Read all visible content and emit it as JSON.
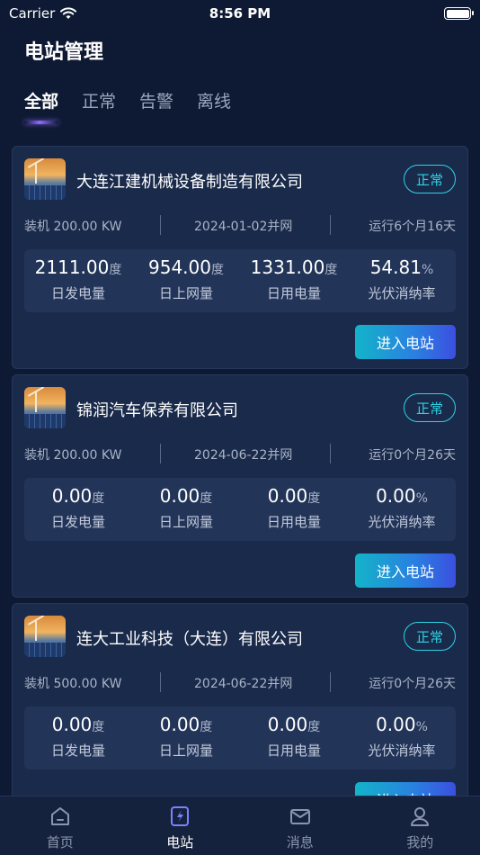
{
  "status_bar": {
    "carrier": "Carrier",
    "time": "8:56 PM",
    "battery_level": 1.0
  },
  "header": {
    "title": "电站管理"
  },
  "tabs": [
    {
      "label": "全部",
      "active": true
    },
    {
      "label": "正常",
      "active": false
    },
    {
      "label": "告警",
      "active": false
    },
    {
      "label": "离线",
      "active": false
    }
  ],
  "stations": [
    {
      "name": "大连江建机械设备制造有限公司",
      "status": "正常",
      "capacity": "装机 200.00 KW",
      "grid_date": "2024-01-02并网",
      "runtime": "运行6个月16天",
      "metrics": [
        {
          "value": "2111.00",
          "unit": "度",
          "label": "日发电量"
        },
        {
          "value": "954.00",
          "unit": "度",
          "label": "日上网量"
        },
        {
          "value": "1331.00",
          "unit": "度",
          "label": "日用电量"
        },
        {
          "value": "54.81",
          "unit": "%",
          "label": "光伏消纳率"
        }
      ],
      "button": "进入电站"
    },
    {
      "name": "锦润汽车保养有限公司",
      "status": "正常",
      "capacity": "装机 200.00 KW",
      "grid_date": "2024-06-22并网",
      "runtime": "运行0个月26天",
      "metrics": [
        {
          "value": "0.00",
          "unit": "度",
          "label": "日发电量"
        },
        {
          "value": "0.00",
          "unit": "度",
          "label": "日上网量"
        },
        {
          "value": "0.00",
          "unit": "度",
          "label": "日用电量"
        },
        {
          "value": "0.00",
          "unit": "%",
          "label": "光伏消纳率"
        }
      ],
      "button": "进入电站"
    },
    {
      "name": "连大工业科技（大连）有限公司",
      "status": "正常",
      "capacity": "装机 500.00 KW",
      "grid_date": "2024-06-22并网",
      "runtime": "运行0个月26天",
      "metrics": [
        {
          "value": "0.00",
          "unit": "度",
          "label": "日发电量"
        },
        {
          "value": "0.00",
          "unit": "度",
          "label": "日上网量"
        },
        {
          "value": "0.00",
          "unit": "度",
          "label": "日用电量"
        },
        {
          "value": "0.00",
          "unit": "%",
          "label": "光伏消纳率"
        }
      ],
      "button": "进入电站"
    }
  ],
  "tabbar": [
    {
      "label": "首页",
      "icon": "home-icon",
      "active": false
    },
    {
      "label": "电站",
      "icon": "power-station-icon",
      "active": true
    },
    {
      "label": "消息",
      "icon": "mail-icon",
      "active": false
    },
    {
      "label": "我的",
      "icon": "user-icon",
      "active": false
    }
  ],
  "colors": {
    "accent": "#2ed3e6",
    "background": "#0e1a33",
    "card": "#1a2a4a"
  }
}
